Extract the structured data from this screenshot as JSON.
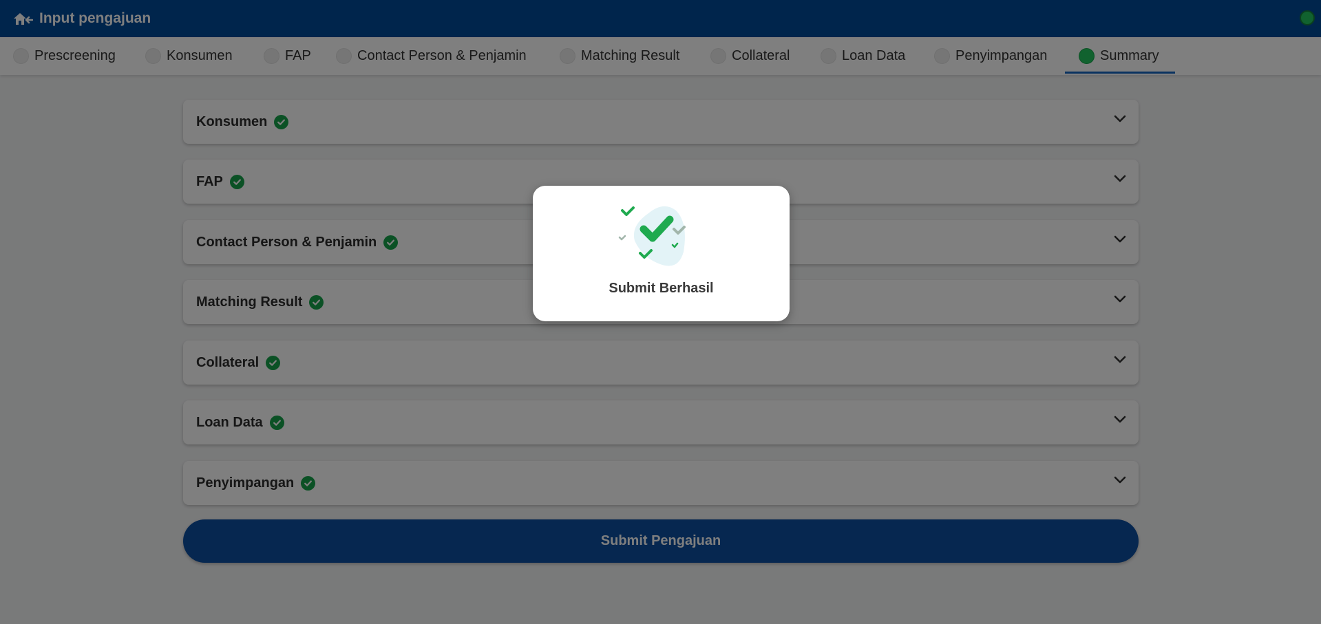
{
  "header": {
    "title": "Input pengajuan",
    "back_icon": "home-back-icon",
    "status_color": "#22c55e"
  },
  "steps": [
    {
      "label": "Prescreening",
      "active": false
    },
    {
      "label": "Konsumen",
      "active": false
    },
    {
      "label": "FAP",
      "active": false
    },
    {
      "label": "Contact Person & Penjamin",
      "active": false
    },
    {
      "label": "Matching Result",
      "active": false
    },
    {
      "label": "Collateral",
      "active": false
    },
    {
      "label": "Loan Data",
      "active": false
    },
    {
      "label": "Penyimpangan",
      "active": false
    },
    {
      "label": "Summary",
      "active": true
    }
  ],
  "sections": [
    {
      "title": "Konsumen",
      "complete": true
    },
    {
      "title": "FAP",
      "complete": true
    },
    {
      "title": "Contact Person & Penjamin",
      "complete": true
    },
    {
      "title": "Matching Result",
      "complete": true
    },
    {
      "title": "Collateral",
      "complete": true
    },
    {
      "title": "Loan Data",
      "complete": true
    },
    {
      "title": "Penyimpangan",
      "complete": true
    }
  ],
  "submit": {
    "label": "Submit Pengajuan"
  },
  "modal": {
    "message": "Submit Berhasil",
    "icon": "success-checkmarks-icon"
  },
  "colors": {
    "primary": "#004a99",
    "success": "#16a34a",
    "active_step": "#22c55e"
  }
}
